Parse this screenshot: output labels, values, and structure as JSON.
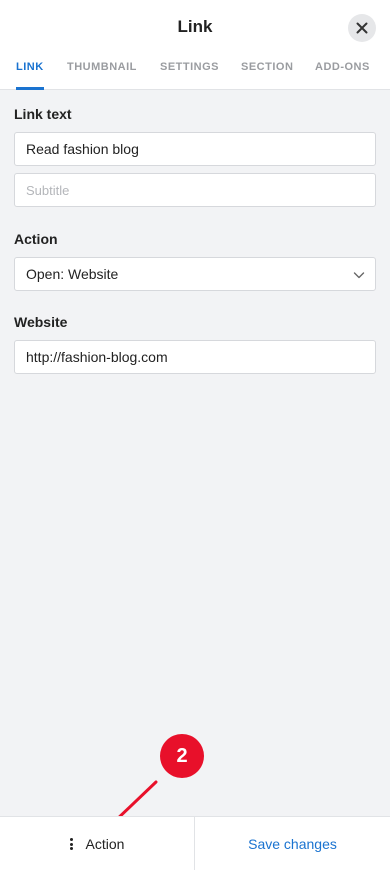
{
  "header": {
    "title": "Link",
    "close_icon": "close-icon"
  },
  "tabs": [
    {
      "label": "LINK",
      "active": true
    },
    {
      "label": "THUMBNAIL",
      "active": false
    },
    {
      "label": "SETTINGS",
      "active": false
    },
    {
      "label": "SECTION",
      "active": false
    },
    {
      "label": "ADD-ONS",
      "active": false
    }
  ],
  "form": {
    "link_text": {
      "label": "Link text",
      "value": "Read fashion blog"
    },
    "subtitle": {
      "placeholder": "Subtitle",
      "value": ""
    },
    "action": {
      "label": "Action",
      "selected": "Open: Website"
    },
    "website": {
      "label": "Website",
      "value": "http://fashion-blog.com"
    }
  },
  "footer": {
    "action_label": "Action",
    "save_label": "Save changes"
  },
  "annotation": {
    "badge": "2"
  },
  "colors": {
    "accent": "#1a73d0",
    "badge": "#e8102a",
    "background": "#f2f3f5"
  }
}
